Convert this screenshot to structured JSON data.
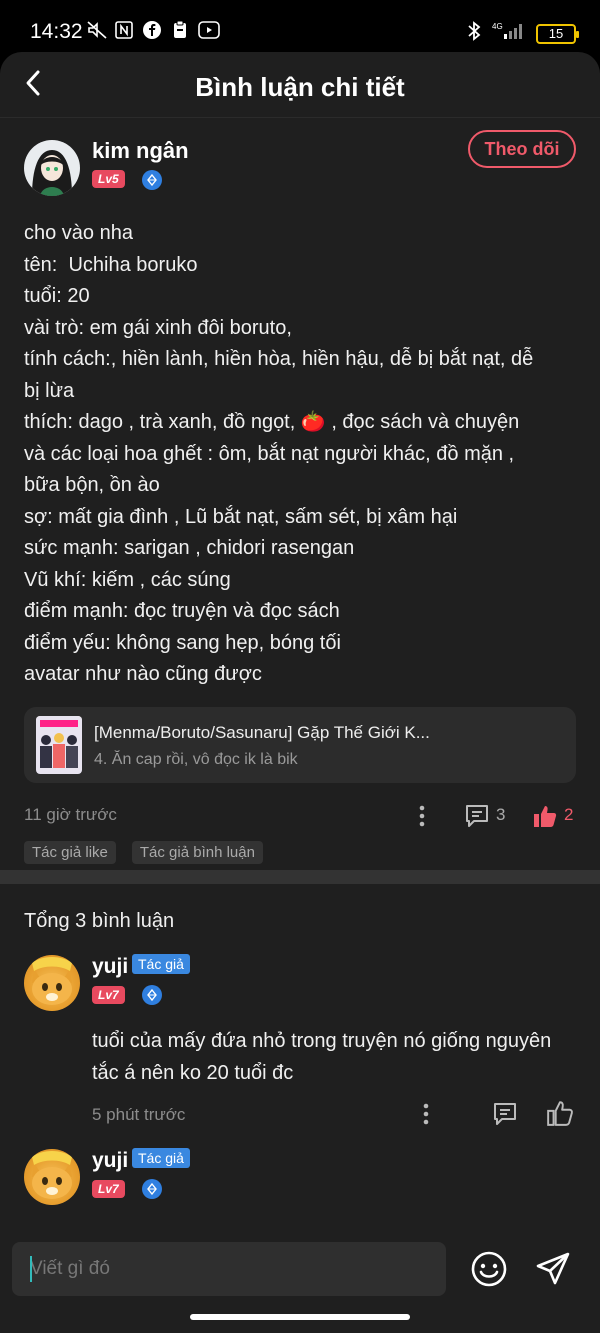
{
  "status": {
    "time": "14:32",
    "battery": "15",
    "network": "4G"
  },
  "header": {
    "title": "Bình luận chi tiết"
  },
  "post": {
    "author": "kim ngân",
    "level": "Lv5",
    "follow_label": "Theo dõi",
    "lines": [
      "cho vào nha",
      "tên:  Uchiha boruko",
      "tuổi: 20",
      "vài trò: em gái xinh đôi boruto,",
      "tính cách:, hiền lành, hiền hòa, hiền hậu, dễ bị bắt nạt, dễ",
      "bị lừa",
      "thích: dago , trà xanh, đồ ngọt, 🍅 , đọc sách và chuyện",
      "và các loại hoa ghết : ôm, bắt nạt người khác, đồ mặn ,",
      "bữa bộn, ồn ào",
      "sợ: mất gia đình , Lũ bắt nạt, sấm sét, bị xâm hại",
      "sức mạnh: sarigan , chidori rasengan",
      "Vũ khí: kiếm , các súng",
      "điểm mạnh: đọc truyện và đọc sách",
      "điểm yếu: không sang hẹp, bóng tối",
      "avatar như nào cũng được"
    ],
    "story_title": "[Menma/Boruto/Sasunaru] Gặp Thế Giới K...",
    "story_sub": "4. Ăn cap rồi, vô đọc ik là bik",
    "time_ago": "11 giờ trước",
    "comment_count": "3",
    "like_count": "2",
    "tags": [
      "Tác giả like",
      "Tác giả bình luận"
    ]
  },
  "comments": {
    "total": "Tổng 3 bình luận",
    "items": [
      {
        "name": "yuji",
        "author_tag": "Tác giả",
        "level": "Lv7",
        "text": "tuổi của mấy đứa nhỏ trong truyện nó giống nguyên tắc á nên ko 20 tuổi đc",
        "time": "5 phút trước"
      },
      {
        "name": "yuji",
        "author_tag": "Tác giả",
        "level": "Lv7"
      }
    ]
  },
  "input": {
    "placeholder": "Viết gì đó"
  }
}
